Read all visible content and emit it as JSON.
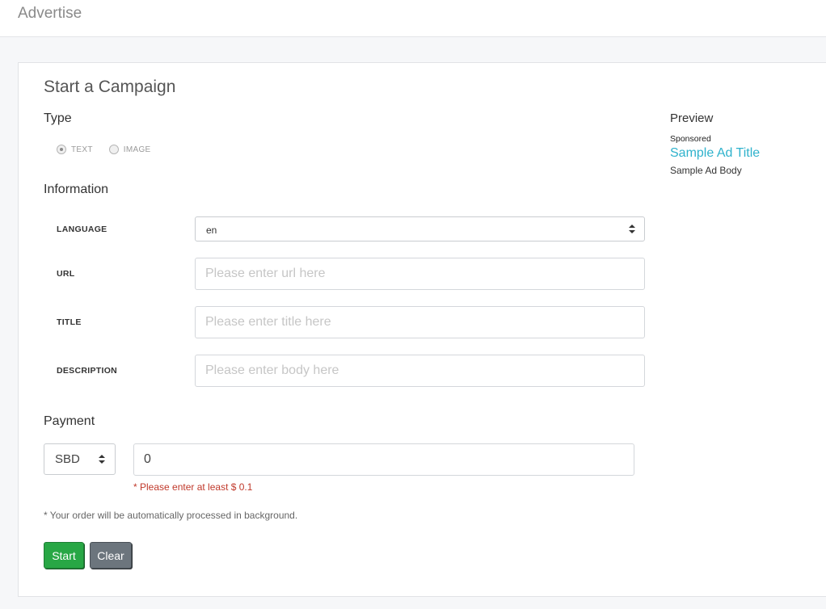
{
  "header": {
    "title": "Advertise"
  },
  "campaign": {
    "title": "Start a Campaign",
    "type": {
      "heading": "Type",
      "options": [
        {
          "label": "TEXT",
          "checked": true
        },
        {
          "label": "IMAGE",
          "checked": false
        }
      ]
    },
    "information": {
      "heading": "Information",
      "language": {
        "label": "LANGUAGE",
        "value": "en"
      },
      "url": {
        "label": "URL",
        "placeholder": "Please enter url here",
        "value": ""
      },
      "title": {
        "label": "TITLE",
        "placeholder": "Please enter title here",
        "value": ""
      },
      "description": {
        "label": "DESCRIPTION",
        "placeholder": "Please enter body here",
        "value": ""
      }
    },
    "payment": {
      "heading": "Payment",
      "currency": "SBD",
      "amount": "0",
      "error": "* Please enter at least $ 0.1"
    },
    "note": "* Your order will be automatically processed in background.",
    "buttons": {
      "start": "Start",
      "clear": "Clear"
    }
  },
  "preview": {
    "heading": "Preview",
    "sponsored": "Sponsored",
    "ad_title": "Sample Ad Title",
    "ad_body": "Sample Ad Body"
  },
  "colors": {
    "start_button": "#28a745",
    "clear_button": "#6c757d",
    "ad_title": "#2fb2cc",
    "error": "#c0392b"
  }
}
